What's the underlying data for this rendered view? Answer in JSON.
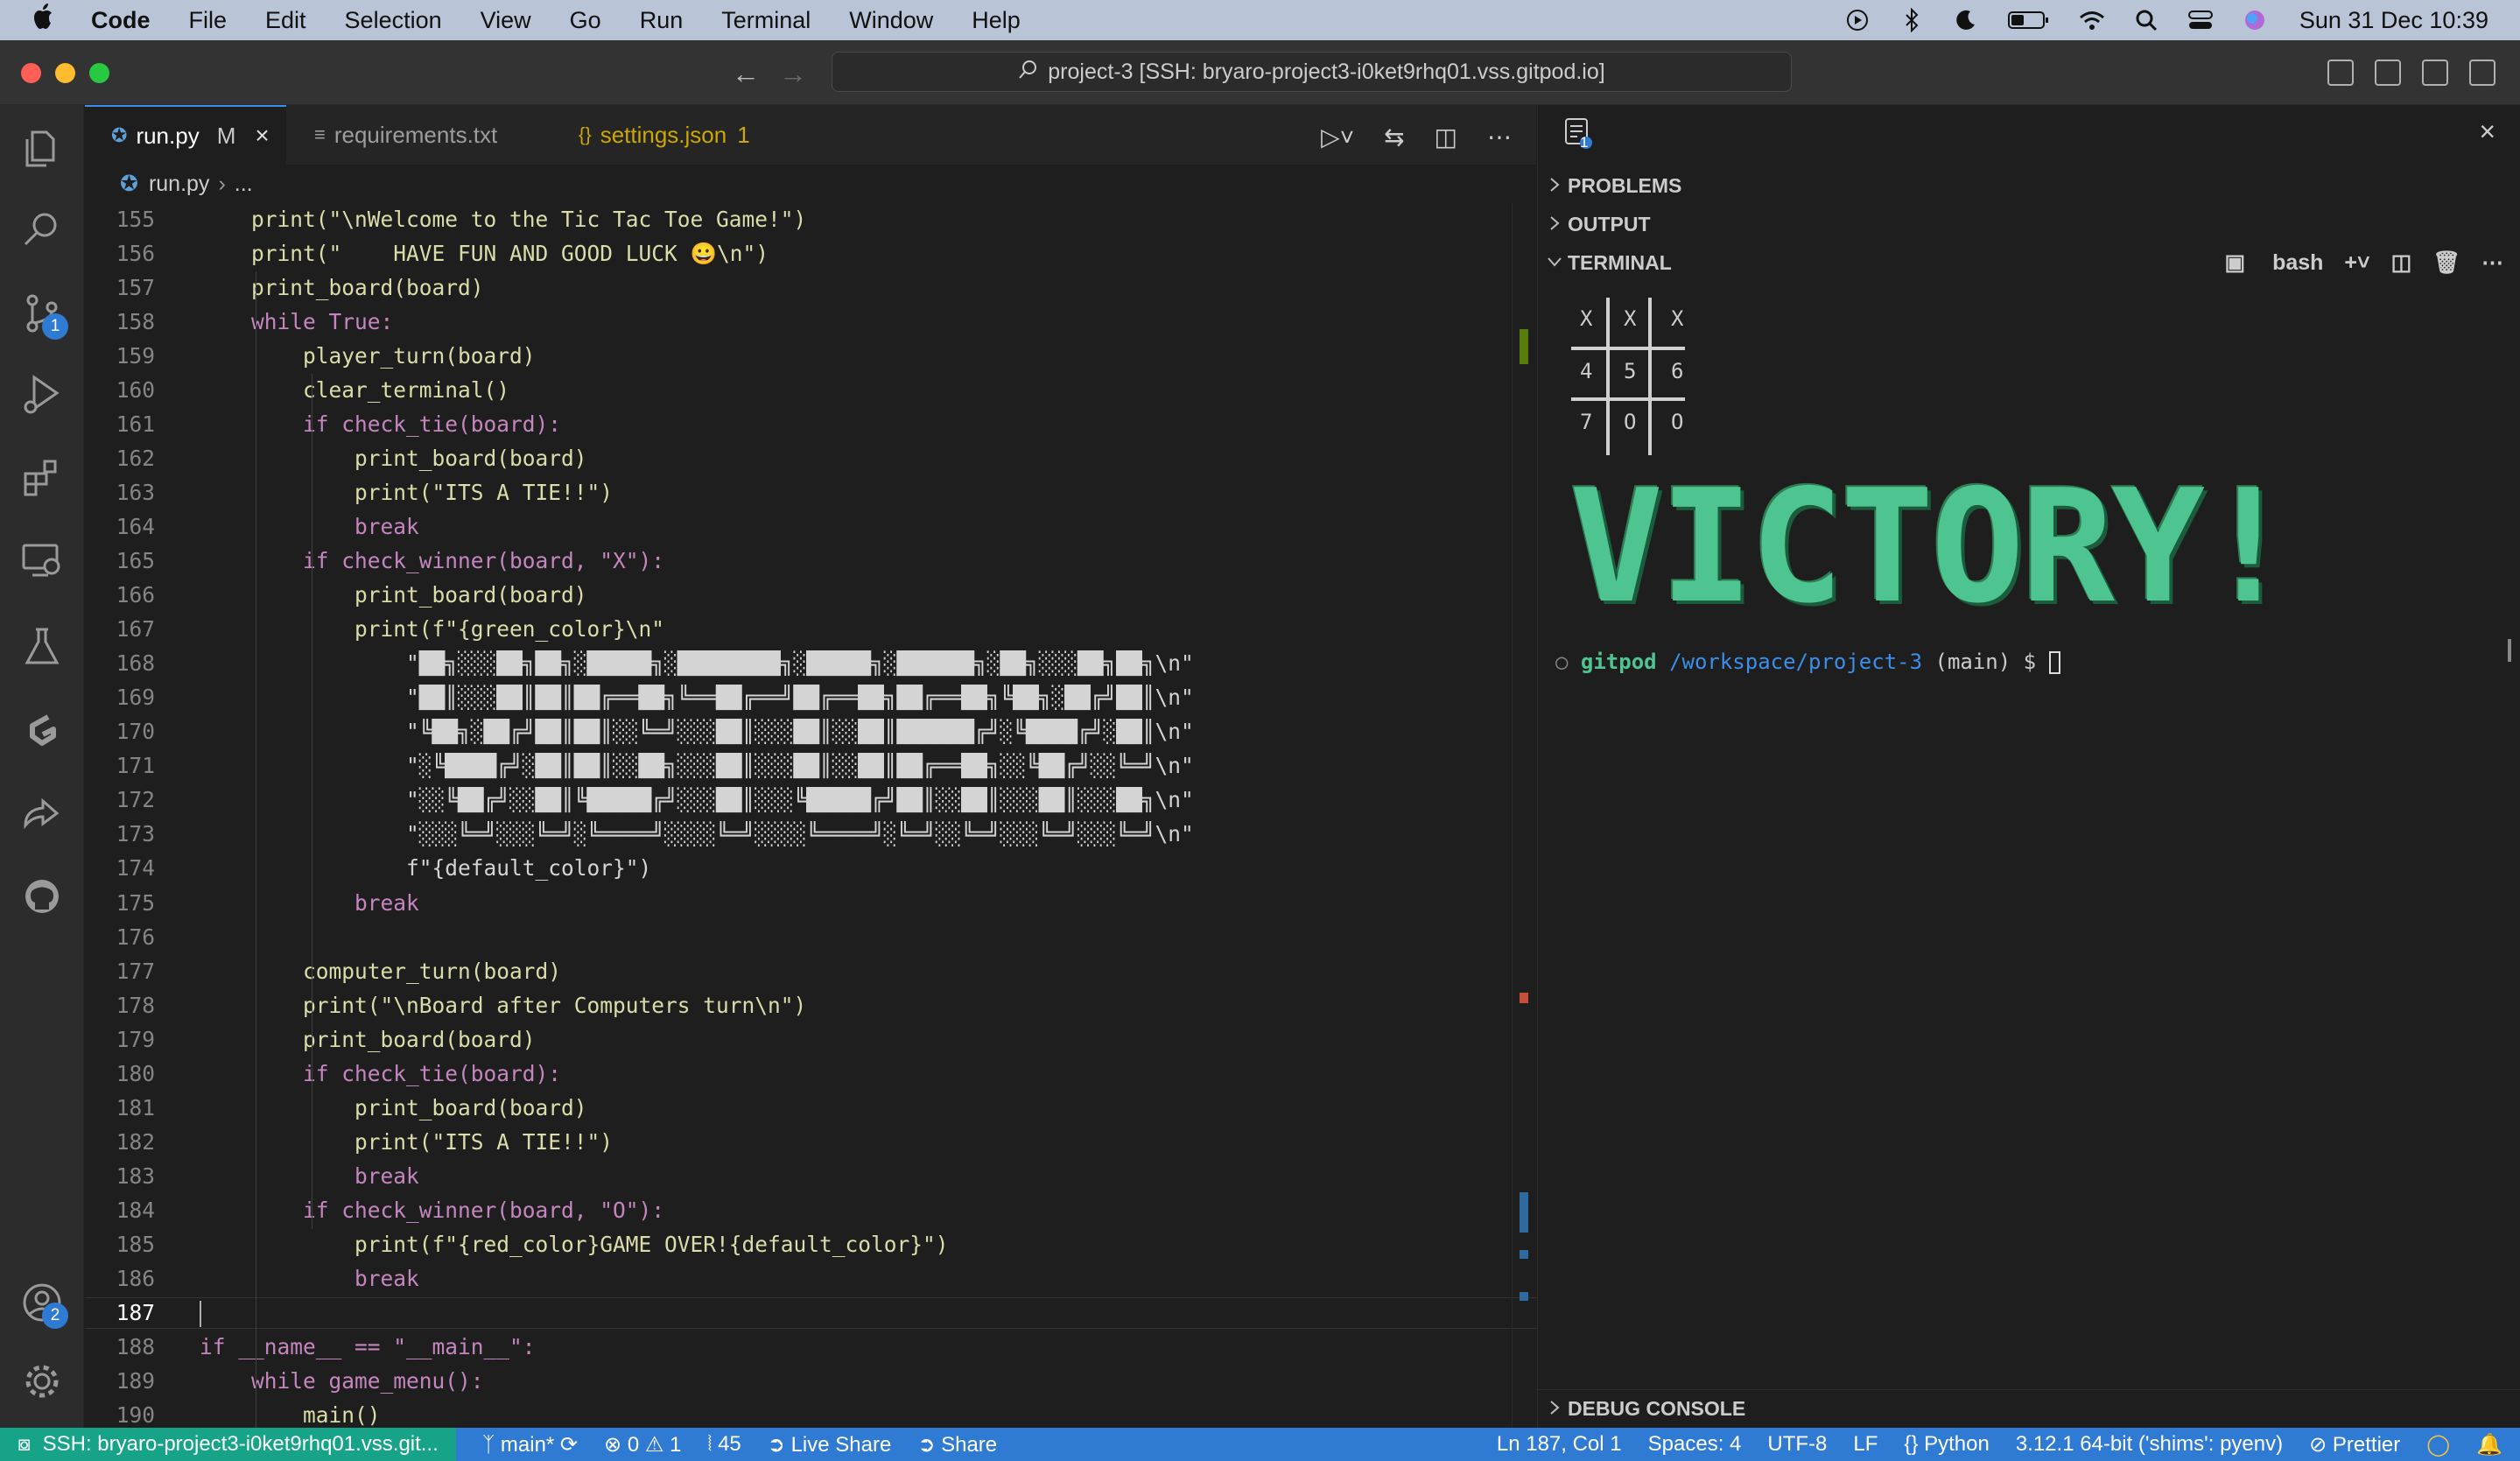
{
  "menubar": {
    "apple_icon": "apple-logo",
    "app_name": "Code",
    "items": [
      "File",
      "Edit",
      "Selection",
      "View",
      "Go",
      "Run",
      "Terminal",
      "Window",
      "Help"
    ],
    "clock": "Sun 31 Dec  10:39"
  },
  "titlebar": {
    "command_center": "project-3 [SSH: bryaro-project3-i0ket9rhq01.vss.gitpod.io]"
  },
  "activity": {
    "scm_badge": "1",
    "accounts_badge": "2"
  },
  "tabs": [
    {
      "label": "run.py",
      "status": "M",
      "icon": "python-icon"
    },
    {
      "label": "requirements.txt",
      "icon": "text-file-icon"
    },
    {
      "label": "settings.json",
      "status": "1",
      "icon": "json-icon"
    }
  ],
  "breadcrumb": {
    "file": "run.py",
    "more": "..."
  },
  "code": {
    "lines": [
      {
        "n": "155",
        "t": "    print(\"\\nWelcome to the Tic Tac Toe Game!\")"
      },
      {
        "n": "156",
        "t": "    print(\"    HAVE FUN AND GOOD LUCK 😀\\n\")"
      },
      {
        "n": "157",
        "t": "    print_board(board)"
      },
      {
        "n": "158",
        "t": "    while True:"
      },
      {
        "n": "159",
        "t": "        player_turn(board)"
      },
      {
        "n": "160",
        "t": "        clear_terminal()"
      },
      {
        "n": "161",
        "t": "        if check_tie(board):"
      },
      {
        "n": "162",
        "t": "            print_board(board)"
      },
      {
        "n": "163",
        "t": "            print(\"ITS A TIE!!\")"
      },
      {
        "n": "164",
        "t": "            break"
      },
      {
        "n": "165",
        "t": "        if check_winner(board, \"X\"):"
      },
      {
        "n": "166",
        "t": "            print_board(board)"
      },
      {
        "n": "167",
        "t": "            print(f\"{green_color}\\n\""
      },
      {
        "n": "168",
        "t": "                \"██╗░░░██╗██╗░█████╗░████████╗░█████╗░██████╗░██╗░░░██╗██╗\\n\""
      },
      {
        "n": "169",
        "t": "                \"██║░░░██║██║██╔══██╗╚══██╔══╝██╔══██╗██╔══██╗╚██╗░██╔╝██║\\n\""
      },
      {
        "n": "170",
        "t": "                \"╚██╗░██╔╝██║██║░░╚═╝░░░██║░░░██║░░██║██████╔╝░╚████╔╝░██║\\n\""
      },
      {
        "n": "171",
        "t": "                \"░╚████╔╝░██║██║░░██╗░░░██║░░░██║░░██║██╔══██╗░░╚██╔╝░░╚═╝\\n\""
      },
      {
        "n": "172",
        "t": "                \"░░╚██╔╝░░██║╚█████╔╝░░░██║░░░╚█████╔╝██║░░██║░░░██║░░░██╗\\n\""
      },
      {
        "n": "173",
        "t": "                \"░░░╚═╝░░░╚═╝░╚════╝░░░░╚═╝░░░░╚════╝░╚═╝░░╚═╝░░░╚═╝░░░╚═╝\\n\""
      },
      {
        "n": "174",
        "t": "                f\"{default_color}\")"
      },
      {
        "n": "175",
        "t": "            break"
      },
      {
        "n": "176",
        "t": ""
      },
      {
        "n": "177",
        "t": "        computer_turn(board)"
      },
      {
        "n": "178",
        "t": "        print(\"\\nBoard after Computers turn\\n\")"
      },
      {
        "n": "179",
        "t": "        print_board(board)"
      },
      {
        "n": "180",
        "t": "        if check_tie(board):"
      },
      {
        "n": "181",
        "t": "            print_board(board)"
      },
      {
        "n": "182",
        "t": "            print(\"ITS A TIE!!\")"
      },
      {
        "n": "183",
        "t": "            break"
      },
      {
        "n": "184",
        "t": "        if check_winner(board, \"O\"):"
      },
      {
        "n": "185",
        "t": "            print(f\"{red_color}GAME OVER!{default_color}\")"
      },
      {
        "n": "186",
        "t": "            break"
      },
      {
        "n": "187",
        "t": ""
      },
      {
        "n": "188",
        "t": "if __name__ == \"__main__\":"
      },
      {
        "n": "189",
        "t": "    while game_menu():"
      },
      {
        "n": "190",
        "t": "        main()"
      }
    ],
    "current_line": "187"
  },
  "panel": {
    "problems": "PROBLEMS",
    "output": "OUTPUT",
    "terminal": "TERMINAL",
    "debug_console": "DEBUG CONSOLE",
    "shell": "bash",
    "header_badge": "1",
    "board": [
      [
        "X",
        "X",
        "X"
      ],
      [
        "4",
        "5",
        "6"
      ],
      [
        "7",
        "O",
        "O"
      ]
    ],
    "banner": "VICTORY!",
    "prompt_user": "gitpod",
    "prompt_path": "/workspace/project-3",
    "prompt_branch": "(main)",
    "prompt_symbol": "$"
  },
  "statusbar": {
    "remote": "SSH: bryaro-project3-i0ket9rhq01.vss.git...",
    "branch": "main*",
    "errors": "0",
    "warnings": "1",
    "ports": "45",
    "live_share": "Live Share",
    "share": "Share",
    "position": "Ln 187, Col 1",
    "spaces": "Spaces: 4",
    "encoding": "UTF-8",
    "eol": "LF",
    "language": "Python",
    "interpreter": "3.12.1 64-bit ('shims': pyenv)",
    "prettier": "Prettier"
  },
  "colors": {
    "accent": "#2f7bd3",
    "remote": "#17a388",
    "victory": "#4ec591",
    "editor_bg": "#1e1e1e"
  }
}
